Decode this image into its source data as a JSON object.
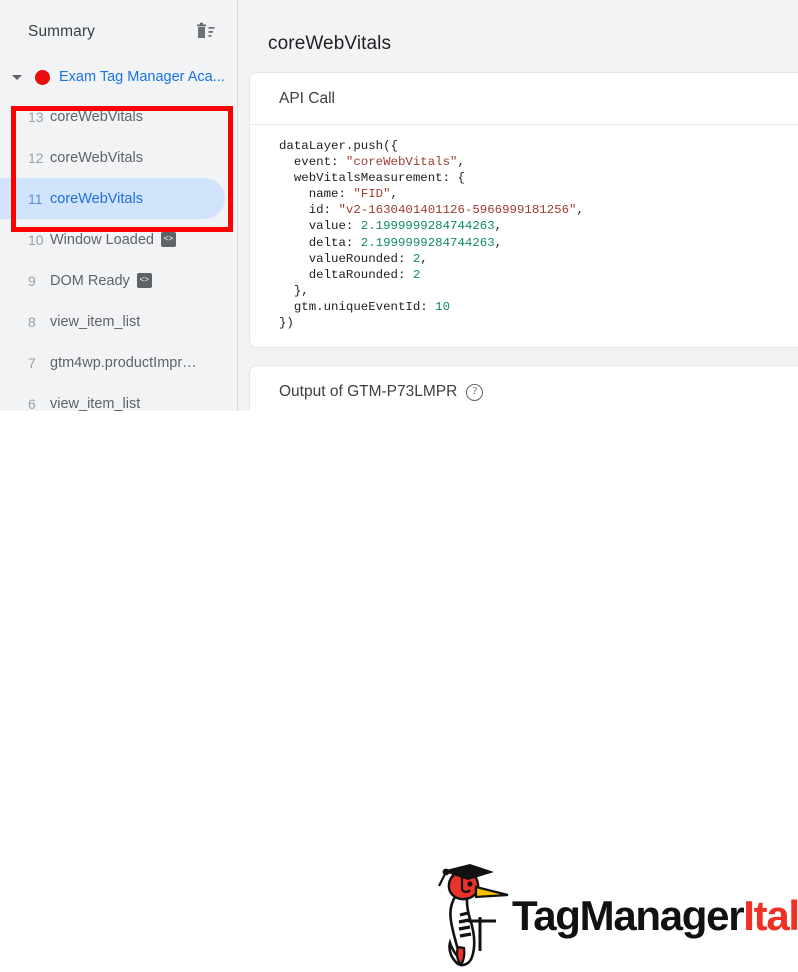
{
  "sidebar": {
    "title": "Summary",
    "delete_icon": "trash-icon",
    "container": {
      "name": "Exam Tag Manager Aca...",
      "status_color": "#ea0b0b",
      "caret_icon": "chevron-down-icon"
    },
    "events": [
      {
        "num": "13",
        "name": "coreWebVitals",
        "badge": "",
        "selected": false
      },
      {
        "num": "12",
        "name": "coreWebVitals",
        "badge": "",
        "selected": false
      },
      {
        "num": "11",
        "name": "coreWebVitals",
        "badge": "",
        "selected": true
      },
      {
        "num": "10",
        "name": "Window Loaded",
        "badge": "<>",
        "selected": false
      },
      {
        "num": "9",
        "name": "DOM Ready",
        "badge": "<>",
        "selected": false
      },
      {
        "num": "8",
        "name": "view_item_list",
        "badge": "",
        "selected": false
      },
      {
        "num": "7",
        "name": "gtm4wp.productImpres...",
        "badge": "",
        "selected": false
      },
      {
        "num": "6",
        "name": "view_item_list",
        "badge": "",
        "selected": false
      }
    ]
  },
  "main": {
    "title": "coreWebVitals",
    "api_card": {
      "heading": "API Call",
      "code_lines": [
        {
          "indent": 0,
          "text": "dataLayer.push({"
        },
        {
          "indent": 1,
          "text": "event: ",
          "string": "\"coreWebVitals\"",
          "tail": ","
        },
        {
          "indent": 1,
          "text": "webVitalsMeasurement: {"
        },
        {
          "indent": 2,
          "text": "name: ",
          "string": "\"FID\"",
          "tail": ","
        },
        {
          "indent": 2,
          "text": "id: ",
          "string": "\"v2-1630401401126-5966999181256\"",
          "tail": ","
        },
        {
          "indent": 2,
          "text": "value: ",
          "number": "2.1999999284744263",
          "tail": ","
        },
        {
          "indent": 2,
          "text": "delta: ",
          "number": "2.1999999284744263",
          "tail": ","
        },
        {
          "indent": 2,
          "text": "valueRounded: ",
          "number": "2",
          "tail": ","
        },
        {
          "indent": 2,
          "text": "deltaRounded: ",
          "number": "2",
          "tail": ""
        },
        {
          "indent": 1,
          "text": "},"
        },
        {
          "indent": 1,
          "text": "gtm.uniqueEventId: ",
          "number": "10",
          "tail": ""
        },
        {
          "indent": 0,
          "text": "})"
        }
      ]
    },
    "output_card": {
      "heading": "Output of GTM-P73LMPR",
      "help_icon": "question-mark-circle-icon",
      "help_glyph": "?"
    }
  },
  "annotation": {
    "color": "#fe0000",
    "label": "red-highlight-rectangle"
  },
  "logo": {
    "bird_icon": "woodpecker-graduate-icon",
    "wordmark_dark": "TagManager",
    "wordmark_red": "Italia",
    "dark_color": "#111111",
    "red_color": "#ee3124"
  }
}
